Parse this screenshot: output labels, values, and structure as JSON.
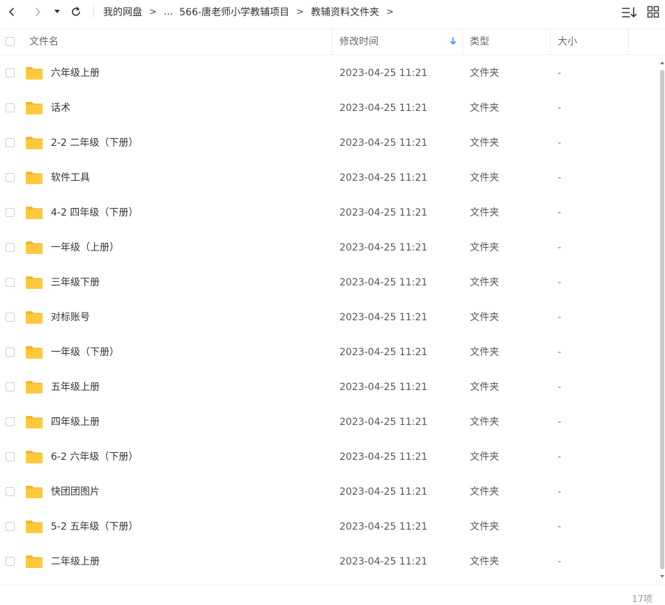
{
  "toolbar": {
    "back_icon": "chevron-left-icon",
    "forward_icon": "chevron-right-icon",
    "dropdown_icon": "caret-down-icon",
    "refresh_icon": "refresh-icon",
    "breadcrumb": [
      "我的网盘",
      "...",
      "566-唐老师小学教辅项目",
      "教辅资料文件夹"
    ],
    "separator": ">",
    "sort_icon": "sort-icon",
    "grid_view_icon": "grid-view-icon"
  },
  "columns": {
    "name": "文件名",
    "modified": "修改时间",
    "type": "类型",
    "size": "大小",
    "sort_indicator_icon": "arrow-down-icon"
  },
  "files": [
    {
      "name": "六年级上册",
      "modified": "2023-04-25 11:21",
      "type": "文件夹",
      "size": "-"
    },
    {
      "name": "话术",
      "modified": "2023-04-25 11:21",
      "type": "文件夹",
      "size": "-"
    },
    {
      "name": "2-2 二年级（下册）",
      "modified": "2023-04-25 11:21",
      "type": "文件夹",
      "size": "-"
    },
    {
      "name": "软件工具",
      "modified": "2023-04-25 11:21",
      "type": "文件夹",
      "size": "-"
    },
    {
      "name": "4-2 四年级（下册）",
      "modified": "2023-04-25 11:21",
      "type": "文件夹",
      "size": "-"
    },
    {
      "name": "一年级（上册）",
      "modified": "2023-04-25 11:21",
      "type": "文件夹",
      "size": "-"
    },
    {
      "name": "三年级下册",
      "modified": "2023-04-25 11:21",
      "type": "文件夹",
      "size": "-"
    },
    {
      "name": "对标账号",
      "modified": "2023-04-25 11:21",
      "type": "文件夹",
      "size": "-"
    },
    {
      "name": "一年级（下册）",
      "modified": "2023-04-25 11:21",
      "type": "文件夹",
      "size": "-"
    },
    {
      "name": "五年级上册",
      "modified": "2023-04-25 11:21",
      "type": "文件夹",
      "size": "-"
    },
    {
      "name": "四年级上册",
      "modified": "2023-04-25 11:21",
      "type": "文件夹",
      "size": "-"
    },
    {
      "name": "6-2 六年级（下册）",
      "modified": "2023-04-25 11:21",
      "type": "文件夹",
      "size": "-"
    },
    {
      "name": "快团团图片",
      "modified": "2023-04-25 11:21",
      "type": "文件夹",
      "size": "-"
    },
    {
      "name": "5-2 五年级（下册）",
      "modified": "2023-04-25 11:21",
      "type": "文件夹",
      "size": "-"
    },
    {
      "name": "二年级上册",
      "modified": "2023-04-25 11:21",
      "type": "文件夹",
      "size": "-"
    }
  ],
  "footer": {
    "count": "17项"
  },
  "colors": {
    "folder": "#FFC83D",
    "folder_tab": "#F5B62A",
    "accent": "#2B8FEF"
  }
}
